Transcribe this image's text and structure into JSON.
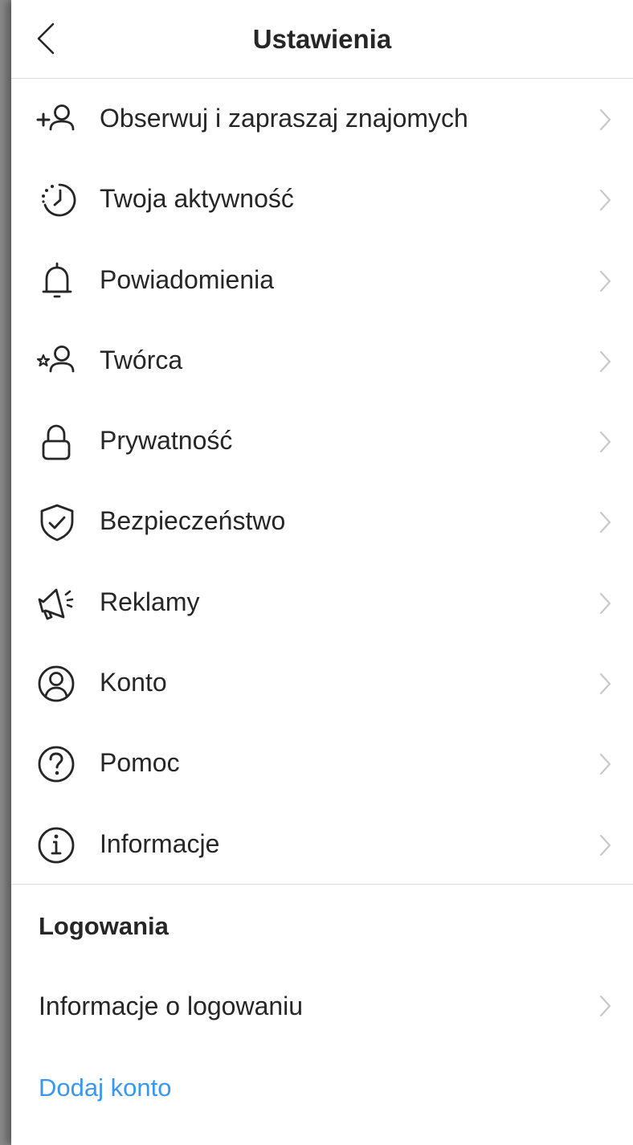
{
  "header": {
    "title": "Ustawienia",
    "back_icon": "chevron-left-icon"
  },
  "menu": {
    "items": [
      {
        "label": "Obserwuj i zapraszaj znajomych",
        "icon": "add-person-icon"
      },
      {
        "label": "Twoja aktywność",
        "icon": "activity-clock-icon"
      },
      {
        "label": "Powiadomienia",
        "icon": "bell-icon"
      },
      {
        "label": "Twórca",
        "icon": "creator-star-person-icon"
      },
      {
        "label": "Prywatność",
        "icon": "lock-icon"
      },
      {
        "label": "Bezpieczeństwo",
        "icon": "shield-check-icon"
      },
      {
        "label": "Reklamy",
        "icon": "megaphone-icon"
      },
      {
        "label": "Konto",
        "icon": "account-circle-icon"
      },
      {
        "label": "Pomoc",
        "icon": "help-question-icon"
      },
      {
        "label": "Informacje",
        "icon": "info-icon"
      }
    ]
  },
  "logins": {
    "section_title": "Logowania",
    "login_info_label": "Informacje o logowaniu",
    "add_account_label": "Dodaj konto"
  },
  "colors": {
    "text": "#262626",
    "link": "#3897f0",
    "chevron": "#c7c7cc",
    "divider": "#dbdbdb"
  }
}
